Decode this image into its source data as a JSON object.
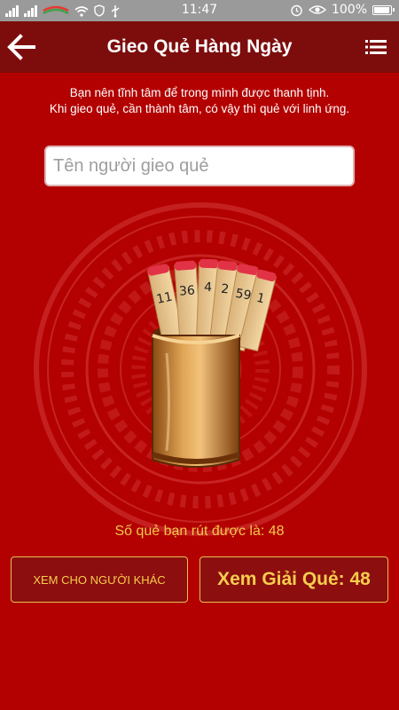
{
  "status_bar": {
    "time": "11:47",
    "battery": "100%",
    "battery_level": 1.0,
    "left_icons": [
      "signal-icon",
      "signal-icon",
      "carrier-logo-icon",
      "wifi-icon",
      "shield-icon",
      "usb-icon"
    ],
    "right_icons": [
      "alarm-icon",
      "eye-icon",
      "battery-icon"
    ]
  },
  "header": {
    "title": "Gieo Quẻ Hàng Ngày",
    "back_icon": "arrow-left-icon",
    "menu_icon": "list-menu-icon"
  },
  "instruction": {
    "line1": "Bạn nên tĩnh tâm để trong mình được thanh tịnh.",
    "line2": "Khi gieo quẻ, cần thành tâm, có vậy thì quẻ với linh ứng."
  },
  "name_input": {
    "placeholder": "Tên người gieo quẻ",
    "value": ""
  },
  "artwork": {
    "sticks": [
      "11",
      "36",
      "4",
      "2",
      "59",
      "1"
    ]
  },
  "result": {
    "text": "Số quẻ bạn rút được là: 48"
  },
  "buttons": {
    "other_person": "XEM CHO NGƯỜI KHÁC",
    "interpret": "Xem Giải Quẻ: 48"
  },
  "colors": {
    "background": "#b30000",
    "app_bar": "#7d0d0d",
    "status_bar": "#9a9a9a",
    "gold_text": "#f0c74d",
    "button_bg": "#8c0e0e",
    "button_border": "#e6bf52"
  }
}
